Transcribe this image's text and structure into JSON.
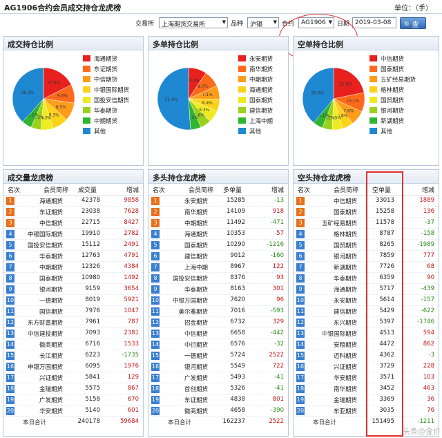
{
  "header": {
    "title": "AG1906合约会员成交持仓龙虎榜",
    "unit": "单位：（手）"
  },
  "filters": {
    "exchange_label": "交易所",
    "exchange_value": "上海期货交易所",
    "product_label": "品种",
    "product_value": "沪银",
    "contract_label": "合约",
    "contract_value": "AG1906",
    "date_label": "日期",
    "date_value": "2019-03-08",
    "query_button": "查询"
  },
  "charts": [
    {
      "title": "成交持仓比例",
      "legend": [
        {
          "label": "海通期货",
          "color": "#e8201e"
        },
        {
          "label": "东证期货",
          "color": "#ff6a1a"
        },
        {
          "label": "中信期货",
          "color": "#ff9d1a"
        },
        {
          "label": "中银国际期货",
          "color": "#ffd21a"
        },
        {
          "label": "国投安信期货",
          "color": "#f0ea20"
        },
        {
          "label": "华泰期货",
          "color": "#9bd11e"
        },
        {
          "label": "中期期货",
          "color": "#2fb52f"
        },
        {
          "label": "其他",
          "color": "#1f88d2"
        }
      ],
      "slice_labels": [
        "17.6%",
        "9.6%",
        "9.5%",
        "8.3%",
        "6.3%",
        "5.3%",
        "5.1%",
        "38.3%"
      ]
    },
    {
      "title": "多单持仓比例",
      "legend": [
        {
          "label": "永安期货",
          "color": "#e8201e"
        },
        {
          "label": "南华期货",
          "color": "#ff6a1a"
        },
        {
          "label": "中期期货",
          "color": "#ff9d1a"
        },
        {
          "label": "海通期货",
          "color": "#ffd21a"
        },
        {
          "label": "国泰期货",
          "color": "#f0ea20"
        },
        {
          "label": "建信期货",
          "color": "#9bd11e"
        },
        {
          "label": "上海中期",
          "color": "#2fb52f"
        },
        {
          "label": "其他",
          "color": "#1f88d2"
        }
      ],
      "slice_labels": [
        "9.4%",
        "8.7%",
        "7.1%",
        "6.4%",
        "6.3%",
        "5.6%",
        "5.5%",
        "51.0%"
      ]
    },
    {
      "title": "空单持仓比例",
      "legend": [
        {
          "label": "中信期货",
          "color": "#e8201e"
        },
        {
          "label": "国泰期货",
          "color": "#ff6a1a"
        },
        {
          "label": "五矿经易期货",
          "color": "#ff9d1a"
        },
        {
          "label": "格林期货",
          "color": "#ffd21a"
        },
        {
          "label": "国贸期货",
          "color": "#f0ea20"
        },
        {
          "label": "银河期货",
          "color": "#9bd11e"
        },
        {
          "label": "新湖期货",
          "color": "#2fb52f"
        },
        {
          "label": "其他",
          "color": "#1f88d2"
        }
      ],
      "slice_labels": [
        "21.8%",
        "10.1%",
        "7.6%",
        "5.8%",
        "5.5%",
        "5.2%",
        "5.1%",
        "39.0%"
      ]
    }
  ],
  "chart_data": [
    {
      "type": "pie",
      "title": "成交持仓比例",
      "categories": [
        "海通期货",
        "东证期货",
        "中信期货",
        "中银国际期货",
        "国投安信期货",
        "华泰期货",
        "中期期货",
        "其他"
      ],
      "values": [
        17.6,
        9.6,
        9.5,
        8.3,
        6.3,
        5.3,
        5.1,
        38.3
      ]
    },
    {
      "type": "pie",
      "title": "多单持仓比例",
      "categories": [
        "永安期货",
        "南华期货",
        "中期期货",
        "海通期货",
        "国泰期货",
        "建信期货",
        "上海中期",
        "其他"
      ],
      "values": [
        9.4,
        8.7,
        7.1,
        6.4,
        6.3,
        5.6,
        5.5,
        51.0
      ]
    },
    {
      "type": "pie",
      "title": "空单持仓比例",
      "categories": [
        "中信期货",
        "国泰期货",
        "五矿经易期货",
        "格林期货",
        "国贸期货",
        "银河期货",
        "新湖期货",
        "其他"
      ],
      "values": [
        21.8,
        10.1,
        7.6,
        5.8,
        5.5,
        5.2,
        5.1,
        39.0
      ]
    }
  ],
  "tables": [
    {
      "title": "成交量龙虎榜",
      "headers": [
        "名次",
        "会员简称",
        "成交量",
        "增减"
      ],
      "rows": [
        [
          "1",
          "海通期货",
          "42378",
          "9858"
        ],
        [
          "2",
          "东证期货",
          "23038",
          "7628"
        ],
        [
          "3",
          "中信期货",
          "22715",
          "8427"
        ],
        [
          "4",
          "中银国际期货",
          "19910",
          "2782"
        ],
        [
          "5",
          "国投安信期货",
          "15112",
          "2491"
        ],
        [
          "6",
          "华泰期货",
          "12763",
          "4791"
        ],
        [
          "7",
          "中期期货",
          "12326",
          "4384"
        ],
        [
          "8",
          "国泰期货",
          "10980",
          "1492"
        ],
        [
          "9",
          "银河期货",
          "9159",
          "3654"
        ],
        [
          "10",
          "一德期货",
          "8019",
          "5921"
        ],
        [
          "11",
          "国信期货",
          "7976",
          "1047"
        ],
        [
          "12",
          "东方财富期货",
          "7961",
          "787"
        ],
        [
          "13",
          "中信建投期货",
          "7093",
          "2381"
        ],
        [
          "14",
          "徽商期货",
          "6716",
          "1533"
        ],
        [
          "15",
          "长江期货",
          "6223",
          "-1735"
        ],
        [
          "16",
          "申银万国期货",
          "6095",
          "1976"
        ],
        [
          "17",
          "兴证期货",
          "5841",
          "129"
        ],
        [
          "18",
          "金瑞期货",
          "5575",
          "867"
        ],
        [
          "19",
          "广发期货",
          "5158",
          "670"
        ],
        [
          "20",
          "华安期货",
          "5140",
          "601"
        ]
      ],
      "total": [
        "本日合计",
        "240178",
        "59684"
      ]
    },
    {
      "title": "多头持仓龙虎榜",
      "headers": [
        "名次",
        "会员简称",
        "多单量",
        "增减"
      ],
      "rows": [
        [
          "1",
          "永安期货",
          "15285",
          "-13"
        ],
        [
          "2",
          "南华期货",
          "14109",
          "918"
        ],
        [
          "3",
          "中期期货",
          "11492",
          "-471"
        ],
        [
          "4",
          "海通期货",
          "10353",
          "57"
        ],
        [
          "5",
          "国泰期货",
          "10290",
          "-1216"
        ],
        [
          "6",
          "建信期货",
          "9012",
          "-160"
        ],
        [
          "7",
          "上海中期",
          "8967",
          "122"
        ],
        [
          "8",
          "国投安信期货",
          "8376",
          "93"
        ],
        [
          "9",
          "华泰期货",
          "8163",
          "301"
        ],
        [
          "10",
          "中银万国期货",
          "7620",
          "96"
        ],
        [
          "11",
          "美尔雅期货",
          "7016",
          "-593"
        ],
        [
          "12",
          "招金期货",
          "6732",
          "329"
        ],
        [
          "13",
          "中信期货",
          "6658",
          "-442"
        ],
        [
          "14",
          "中衍期货",
          "6576",
          "-32"
        ],
        [
          "15",
          "一德期货",
          "5724",
          "2522"
        ],
        [
          "16",
          "银河期货",
          "5549",
          "722"
        ],
        [
          "17",
          "广发期货",
          "5493",
          "-41"
        ],
        [
          "18",
          "首创期货",
          "5326",
          "-41"
        ],
        [
          "19",
          "东证期货",
          "4838",
          "801"
        ],
        [
          "20",
          "徽商期货",
          "4658",
          "-390"
        ]
      ],
      "total": [
        "本日合计",
        "162237",
        "2522"
      ]
    },
    {
      "title": "空头持仓龙虎榜",
      "headers": [
        "名次",
        "会员简称",
        "空单量",
        "增减"
      ],
      "rows": [
        [
          "1",
          "中信期货",
          "33013",
          "1889"
        ],
        [
          "2",
          "国泰期货",
          "15258",
          "136"
        ],
        [
          "3",
          "五矿经易期货",
          "11578",
          "-37"
        ],
        [
          "4",
          "格林期货",
          "8787",
          "-158"
        ],
        [
          "5",
          "国贸期货",
          "8265",
          "-1989"
        ],
        [
          "6",
          "银河期货",
          "7859",
          "777"
        ],
        [
          "7",
          "新湖期货",
          "7726",
          "68"
        ],
        [
          "8",
          "华泰期货",
          "6359",
          "90"
        ],
        [
          "9",
          "海通期货",
          "5717",
          "-439"
        ],
        [
          "10",
          "永安期货",
          "5614",
          "-157"
        ],
        [
          "11",
          "建信期货",
          "5429",
          "-622"
        ],
        [
          "12",
          "东兴期货",
          "5397",
          "-1746"
        ],
        [
          "13",
          "中银国际期货",
          "4513",
          "594"
        ],
        [
          "14",
          "安粮期货",
          "4472",
          "862"
        ],
        [
          "15",
          "迈科期货",
          "4362",
          "-3"
        ],
        [
          "16",
          "兴证期货",
          "3729",
          "228"
        ],
        [
          "17",
          "华安期货",
          "3571",
          "103"
        ],
        [
          "18",
          "南华期货",
          "3452",
          "463"
        ],
        [
          "19",
          "金瑞期货",
          "3369",
          "36"
        ],
        [
          "20",
          "东亚期货",
          "3035",
          "76"
        ]
      ],
      "total": [
        "本日合计",
        "151495",
        "-1211"
      ]
    }
  ],
  "watermark": "头条@金价",
  "colors": {
    "rank_top": "#e8701a",
    "rank_other": "#3a7fd0",
    "positive": "#c81414",
    "negative": "#2a8a1a",
    "highlight": "#e03030"
  }
}
